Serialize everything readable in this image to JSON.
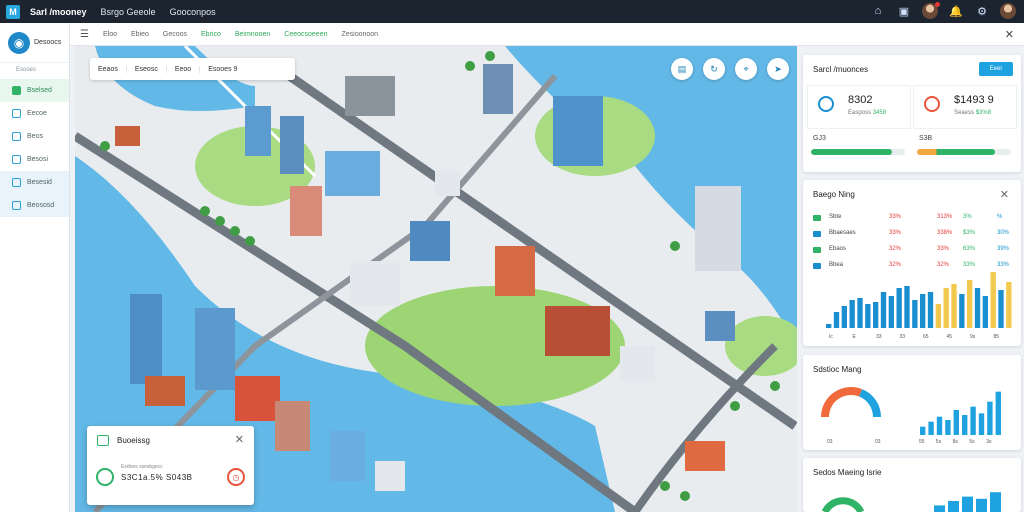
{
  "topbar": {
    "app_title": "Sarl /mooney",
    "menu": [
      "Bsrgo Geeole",
      "Gooconpos"
    ],
    "icons": [
      "home-icon",
      "window-icon",
      "avatar-notification",
      "bell-icon",
      "settings-icon",
      "user-avatar"
    ]
  },
  "subbar": {
    "items": [
      "Eloo",
      "Ebieo",
      "Gecoos",
      "Ebrico",
      "Beimnooen",
      "Ceeocsoeeen",
      "Zesioonoon"
    ],
    "green_items": [
      3,
      4,
      5
    ]
  },
  "sidebar": {
    "brand": "Desoocs",
    "sub": "Esooes",
    "items": [
      {
        "label": "Bselsed",
        "state": "active"
      },
      {
        "label": "Eecoe",
        "state": ""
      },
      {
        "label": "Beos",
        "state": ""
      },
      {
        "label": "Besosi",
        "state": ""
      },
      {
        "label": "Besesid",
        "state": "sel"
      },
      {
        "label": "Beososd",
        "state": "sel"
      }
    ]
  },
  "map": {
    "toolbar": [
      "Eeaos",
      "Eseosc",
      "Eeoo",
      "Esooes 9"
    ],
    "buttons": [
      "layers-icon",
      "refresh-icon",
      "pin-icon",
      "locate-icon"
    ]
  },
  "popup": {
    "title": "Buoeissg",
    "small": "Esdoes ssesbgecc",
    "value": "S3C1a.5% S043B"
  },
  "kpi_panel": {
    "title": "Sarcl /muonces",
    "button": "Eeer",
    "kpis": [
      {
        "value": "8302",
        "sub": "Easposs",
        "delta": "3458",
        "icon": "compass-icon"
      },
      {
        "value": "$1493 9",
        "sub": "Seaess",
        "delta": "$3%8",
        "icon": "clock-icon"
      }
    ],
    "bars": [
      {
        "label": "GJ3",
        "fraction": 0.86,
        "color": "#2fb366"
      },
      {
        "label": "S3B",
        "fraction": 0.83,
        "color": "#f2a53a",
        "color2": "#2fb366"
      }
    ]
  },
  "table_panel": {
    "title": "Baego Ning",
    "rows": [
      {
        "icon_color": "#2fb366",
        "name": "Sbte",
        "c1": "33%",
        "c2": "313%",
        "c3": "3%",
        "c4": "%"
      },
      {
        "icon_color": "#1a8fd0",
        "name": "Bbaesaes",
        "c1": "33%",
        "c2": "338%",
        "c3": "$3%",
        "c4": "30%"
      },
      {
        "icon_color": "#2fb366",
        "name": "Ebaos",
        "c1": "32%",
        "c2": "33%",
        "c3": "63%",
        "c4": "39%"
      },
      {
        "icon_color": "#1a8fd0",
        "name": "Bbea",
        "c1": "32%",
        "c2": "32%",
        "c3": "33%",
        "c4": "33%"
      }
    ]
  },
  "chart_data": [
    {
      "type": "bar",
      "title": "",
      "categories": [
        "Ic",
        "E",
        "",
        "",
        "",
        "",
        "",
        "",
        "",
        "",
        "",
        "",
        "",
        "",
        "",
        "",
        "",
        "",
        "",
        "",
        "",
        "",
        "",
        ""
      ],
      "series": [
        {
          "values": [
            2,
            8,
            11,
            14,
            15,
            12,
            13,
            18,
            16,
            20,
            21,
            14,
            17,
            18,
            12,
            20,
            22,
            17,
            24,
            20,
            16,
            28,
            19,
            23
          ],
          "colors": [
            "#1a8fd0",
            "#1a8fd0",
            "#1a8fd0",
            "#1a8fd0",
            "#1a8fd0",
            "#1a8fd0",
            "#1a8fd0",
            "#1a8fd0",
            "#1a8fd0",
            "#1a8fd0",
            "#1a8fd0",
            "#1a8fd0",
            "#1a8fd0",
            "#1a8fd0",
            "#f2c94c",
            "#f2c94c",
            "#f2c94c",
            "#1a8fd0",
            "#f2c94c",
            "#1a8fd0",
            "#1a8fd0",
            "#f2c94c",
            "#1a8fd0",
            "#f2c94c"
          ]
        }
      ],
      "x_ticks": [
        "Ic",
        "E",
        "33",
        "33",
        "65",
        "45",
        "9s",
        "85"
      ],
      "ylim": [
        0,
        30
      ]
    },
    {
      "type": "pie",
      "title": "Sdstioc Mang",
      "values": [
        62,
        38
      ],
      "colors": [
        "#f06a3c",
        "#1fa3e0"
      ],
      "labels": [
        "03",
        "03"
      ]
    },
    {
      "type": "bar",
      "values": [
        5,
        8,
        11,
        9,
        15,
        12,
        17,
        13,
        20,
        26
      ],
      "color": "#1fa3e0",
      "x_ticks": [
        "55",
        "5s",
        "8s",
        "5s",
        "3s"
      ],
      "ylim": [
        0,
        30
      ]
    },
    {
      "type": "bar",
      "title": "Sedos Maeing Isrie",
      "values": [
        3,
        5,
        7,
        6,
        9
      ],
      "color": "#1fa3e0",
      "ylim": [
        0,
        10
      ]
    }
  ]
}
